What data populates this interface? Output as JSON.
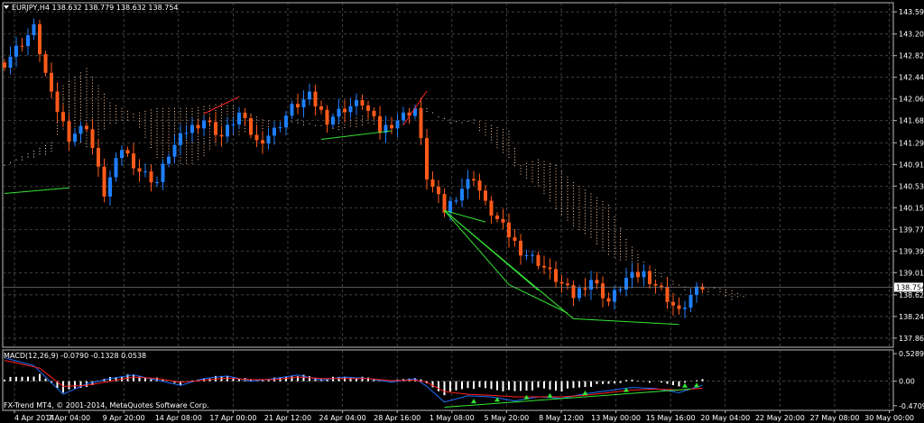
{
  "header": {
    "symbol_line": "EURJPY,H4  138.632 138.779 138.632 138.754",
    "macd_line": "MACD(12,26,9) -0.0790 -0.1328 0.0538",
    "footer": "FX-Trend MT4, © 2001-2014, MetaQuotes Software Corp."
  },
  "colors": {
    "background": "#000000",
    "grid": "#5a5a5a",
    "bull": "#1f7fff",
    "bear": "#ff5a1a",
    "cloud_a": "#ffc8a0",
    "cloud_b": "#f0f0f0",
    "trend": "#34e634",
    "red_line": "#ff2020",
    "macd_hist": "#ffffff",
    "macd_blue": "#1f6fff",
    "macd_red": "#ff2020"
  },
  "chart_data": [
    {
      "type": "candlestick",
      "symbol": "EURJPY",
      "timeframe": "H4",
      "ylim": [
        137.7,
        143.75
      ],
      "price_labels": [
        "143.590",
        "143.200",
        "142.820",
        "142.440",
        "142.060",
        "141.680",
        "141.290",
        "140.910",
        "140.530",
        "140.150",
        "139.770",
        "139.390",
        "139.010",
        "138.620",
        "138.240",
        "137.860"
      ],
      "current_price": "138.754",
      "time_labels": [
        "4 Apr 2014",
        "7 Apr 04:00",
        "9 Apr 20:00",
        "14 Apr 08:00",
        "17 Apr 00:00",
        "21 Apr 12:00",
        "24 Apr 04:00",
        "28 Apr 16:00",
        "1 May 08:00",
        "5 May 20:00",
        "8 May 12:00",
        "13 May 00:00",
        "15 May 16:00",
        "20 May 04:00",
        "22 May 20:00",
        "27 May 08:00",
        "30 May 00:00"
      ],
      "anchors": [
        [
          0,
          142.7
        ],
        [
          5,
          143.3
        ],
        [
          8,
          142.1
        ],
        [
          11,
          141.4
        ],
        [
          14,
          141.6
        ],
        [
          17,
          140.4
        ],
        [
          20,
          141.2
        ],
        [
          23,
          140.8
        ],
        [
          26,
          140.6
        ],
        [
          28,
          141.1
        ],
        [
          31,
          141.5
        ],
        [
          34,
          141.7
        ],
        [
          37,
          141.4
        ],
        [
          40,
          141.8
        ],
        [
          43,
          141.3
        ],
        [
          46,
          141.5
        ],
        [
          49,
          141.9
        ],
        [
          52,
          142.1
        ],
        [
          55,
          141.7
        ],
        [
          58,
          141.9
        ],
        [
          61,
          142.0
        ],
        [
          64,
          141.5
        ],
        [
          67,
          141.7
        ],
        [
          70,
          141.9
        ],
        [
          72,
          140.7
        ],
        [
          75,
          140.1
        ],
        [
          78,
          140.5
        ],
        [
          80,
          140.7
        ],
        [
          82,
          140.2
        ],
        [
          85,
          139.8
        ],
        [
          88,
          139.4
        ],
        [
          91,
          139.2
        ],
        [
          94,
          138.9
        ],
        [
          97,
          138.6
        ],
        [
          100,
          138.9
        ],
        [
          103,
          138.5
        ],
        [
          106,
          138.9
        ],
        [
          109,
          139.0
        ],
        [
          112,
          138.7
        ],
        [
          115,
          138.3
        ],
        [
          117,
          138.6
        ],
        [
          119,
          138.75
        ]
      ],
      "cloud": [
        [
          0,
          140.9,
          140.9
        ],
        [
          8,
          141.1,
          141.3
        ],
        [
          10,
          142.3,
          141.5
        ],
        [
          14,
          142.6,
          141.2
        ],
        [
          18,
          142.0,
          141.6
        ],
        [
          22,
          141.8,
          141.7
        ],
        [
          26,
          141.9,
          141.0
        ],
        [
          32,
          141.9,
          140.9
        ],
        [
          38,
          142.0,
          141.4
        ],
        [
          44,
          141.7,
          141.5
        ],
        [
          50,
          141.6,
          141.7
        ],
        [
          56,
          141.6,
          141.5
        ],
        [
          62,
          141.8,
          141.6
        ],
        [
          68,
          141.7,
          141.6
        ],
        [
          72,
          141.9,
          141.8
        ],
        [
          76,
          141.6,
          141.7
        ],
        [
          80,
          141.7,
          141.6
        ],
        [
          83,
          141.6,
          141.3
        ],
        [
          86,
          141.5,
          141.0
        ],
        [
          88,
          140.9,
          140.7
        ],
        [
          91,
          141.0,
          140.5
        ],
        [
          94,
          140.9,
          140.1
        ],
        [
          97,
          140.6,
          139.8
        ],
        [
          100,
          140.4,
          139.6
        ],
        [
          103,
          140.2,
          139.3
        ],
        [
          106,
          139.6,
          139.2
        ],
        [
          109,
          139.2,
          139.0
        ],
        [
          112,
          139.0,
          138.9
        ],
        [
          115,
          138.8,
          138.75
        ],
        [
          118,
          138.7,
          138.6
        ],
        [
          121,
          138.75,
          138.7
        ],
        [
          124,
          138.7,
          138.5
        ],
        [
          126,
          138.6,
          138.6
        ]
      ],
      "trendlines": [
        {
          "color": "trend",
          "points": [
            [
              75,
              140.1
            ],
            [
              82,
              139.9
            ]
          ]
        },
        {
          "color": "trend",
          "points": [
            [
              75,
              140.1
            ],
            [
              86,
              138.8
            ]
          ]
        },
        {
          "color": "trend",
          "points": [
            [
              75,
              140.1
            ],
            [
              91,
              138.7
            ]
          ]
        },
        {
          "color": "trend",
          "points": [
            [
              75,
              140.1
            ],
            [
              97,
              138.2
            ]
          ]
        },
        {
          "color": "trend",
          "points": [
            [
              97,
              138.2
            ],
            [
              115,
              138.1
            ]
          ]
        },
        {
          "color": "trend",
          "points": [
            [
              86,
              138.8
            ],
            [
              96,
              138.3
            ]
          ]
        },
        {
          "color": "trend",
          "points": [
            [
              0,
              140.4
            ],
            [
              11,
              140.5
            ]
          ]
        },
        {
          "color": "trend",
          "points": [
            [
              54,
              141.35
            ],
            [
              66,
              141.5
            ]
          ]
        },
        {
          "color": "red_line",
          "points": [
            [
              34,
              141.8
            ],
            [
              40,
              142.1
            ]
          ]
        },
        {
          "color": "red_line",
          "points": [
            [
              68,
              141.6
            ],
            [
              72,
              142.2
            ]
          ]
        }
      ]
    },
    {
      "type": "macd",
      "label": "MACD(12,26,9)",
      "values": [
        "-0.0790",
        "-0.1328",
        "0.0538"
      ],
      "ylim": [
        -0.56,
        0.6
      ],
      "axis_labels": [
        "0.5289",
        "0.00",
        "-0.4709"
      ],
      "hist_anchors": [
        [
          0,
          0.05
        ],
        [
          6,
          0.12
        ],
        [
          10,
          -0.2
        ],
        [
          14,
          -0.1
        ],
        [
          18,
          0.08
        ],
        [
          22,
          0.12
        ],
        [
          26,
          0.05
        ],
        [
          30,
          -0.05
        ],
        [
          34,
          0.06
        ],
        [
          38,
          0.1
        ],
        [
          42,
          0.02
        ],
        [
          46,
          0.05
        ],
        [
          50,
          0.12
        ],
        [
          54,
          0.05
        ],
        [
          58,
          0.08
        ],
        [
          62,
          0.06
        ],
        [
          66,
          0.0
        ],
        [
          70,
          0.08
        ],
        [
          72,
          -0.05
        ],
        [
          75,
          -0.25
        ],
        [
          79,
          -0.12
        ],
        [
          83,
          -0.15
        ],
        [
          87,
          -0.2
        ],
        [
          91,
          -0.14
        ],
        [
          95,
          -0.18
        ],
        [
          99,
          -0.1
        ],
        [
          103,
          -0.05
        ],
        [
          107,
          0.02
        ],
        [
          111,
          -0.02
        ],
        [
          115,
          -0.08
        ],
        [
          119,
          0.05
        ]
      ],
      "line1_anchors": [
        [
          0,
          0.45
        ],
        [
          5,
          0.3
        ],
        [
          10,
          -0.25
        ],
        [
          14,
          -0.05
        ],
        [
          18,
          0.05
        ],
        [
          22,
          0.12
        ],
        [
          26,
          0.02
        ],
        [
          30,
          -0.08
        ],
        [
          34,
          0.05
        ],
        [
          38,
          0.1
        ],
        [
          42,
          0.0
        ],
        [
          46,
          0.05
        ],
        [
          50,
          0.12
        ],
        [
          54,
          0.02
        ],
        [
          58,
          0.08
        ],
        [
          62,
          0.05
        ],
        [
          66,
          -0.02
        ],
        [
          70,
          0.05
        ],
        [
          72,
          -0.1
        ],
        [
          75,
          -0.4
        ],
        [
          79,
          -0.28
        ],
        [
          83,
          -0.3
        ],
        [
          87,
          -0.38
        ],
        [
          91,
          -0.3
        ],
        [
          95,
          -0.33
        ],
        [
          99,
          -0.24
        ],
        [
          103,
          -0.18
        ],
        [
          107,
          -0.12
        ],
        [
          111,
          -0.14
        ],
        [
          115,
          -0.22
        ],
        [
          119,
          -0.079
        ]
      ],
      "line2_anchors": [
        [
          0,
          0.4
        ],
        [
          6,
          0.25
        ],
        [
          10,
          -0.1
        ],
        [
          14,
          -0.08
        ],
        [
          18,
          0.0
        ],
        [
          22,
          0.08
        ],
        [
          26,
          0.05
        ],
        [
          30,
          -0.02
        ],
        [
          34,
          0.02
        ],
        [
          38,
          0.06
        ],
        [
          42,
          0.03
        ],
        [
          46,
          0.03
        ],
        [
          50,
          0.08
        ],
        [
          54,
          0.05
        ],
        [
          58,
          0.05
        ],
        [
          62,
          0.05
        ],
        [
          66,
          0.01
        ],
        [
          70,
          0.02
        ],
        [
          72,
          -0.02
        ],
        [
          75,
          -0.2
        ],
        [
          79,
          -0.25
        ],
        [
          83,
          -0.27
        ],
        [
          87,
          -0.3
        ],
        [
          91,
          -0.3
        ],
        [
          95,
          -0.3
        ],
        [
          99,
          -0.27
        ],
        [
          103,
          -0.22
        ],
        [
          107,
          -0.17
        ],
        [
          111,
          -0.15
        ],
        [
          115,
          -0.17
        ],
        [
          119,
          -0.133
        ]
      ],
      "green_line": [
        [
          75,
          -0.5
        ],
        [
          117,
          -0.15
        ]
      ],
      "arrows": [
        80,
        84,
        89,
        93,
        99,
        106,
        116,
        118
      ]
    }
  ]
}
